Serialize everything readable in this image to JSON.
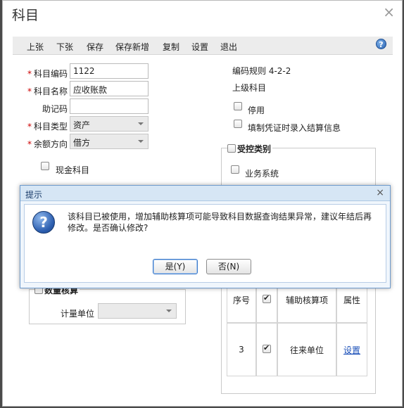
{
  "window": {
    "title": "科目",
    "close": "×"
  },
  "toolbar": {
    "items": [
      "上张",
      "下张",
      "保存",
      "保存新增",
      "复制",
      "设置",
      "退出"
    ],
    "help": "?"
  },
  "form": {
    "required_mark": "*",
    "code_label": "科目编码",
    "code_value": "1122",
    "name_label": "科目名称",
    "name_value": "应收账款",
    "mnemonic_label": "助记码",
    "mnemonic_value": "",
    "type_label": "科目类型",
    "type_value": "资产",
    "balance_label": "余额方向",
    "balance_value": "借方",
    "cash_label": "现金科目"
  },
  "right": {
    "code_rule": "编码规则  4-2-2",
    "parent": "上级科目",
    "disabled": "停用",
    "voucher_settle": "填制凭证时录入结算信息",
    "control_group": "受控类别",
    "business_system": "业务系统"
  },
  "quantity": {
    "group": "数量核算",
    "unit_label": "计量单位",
    "unit_value": ""
  },
  "aux_table": {
    "headers": {
      "seq": "序号",
      "item": "辅助核算项",
      "attr": "属性"
    },
    "rows": [
      {
        "seq": "3",
        "item": "往来单位",
        "attr": "设置"
      }
    ]
  },
  "dialog": {
    "title": "提示",
    "close": "×",
    "icon": "?",
    "message": "该科目已被使用，增加辅助核算项可能导致科目数据查询结果异常，建议年结后再修改。是否确认修改?",
    "yes": "是(Y)",
    "no": "否(N)"
  }
}
